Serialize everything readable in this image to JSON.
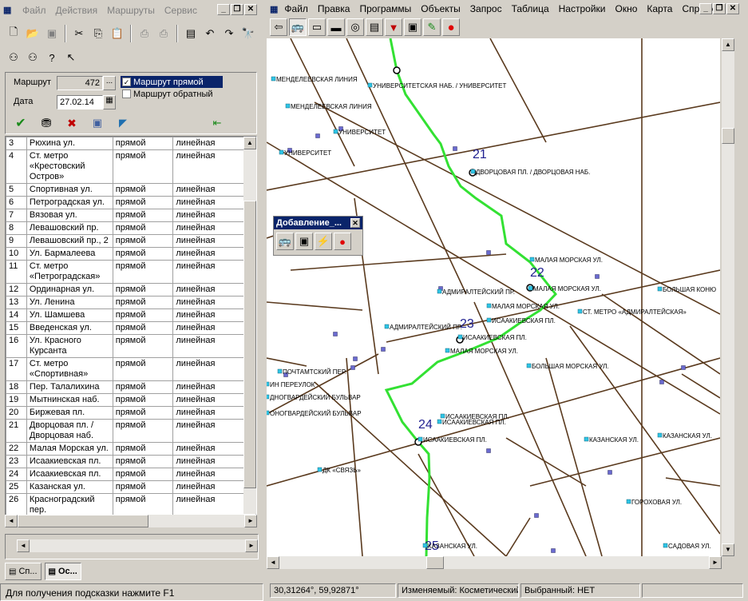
{
  "left_window": {
    "menu": [
      "Файл",
      "Действия",
      "Маршруты",
      "Сервис"
    ],
    "form": {
      "route_label": "Маршрут",
      "route_value": "472",
      "browse_label": "...",
      "date_label": "Дата",
      "date_value": "27.02.14",
      "direct_label": "Маршрут прямой",
      "reverse_label": "Маршрут обратный"
    },
    "rows": [
      [
        "3",
        "Рюхина ул.",
        "прямой",
        "линейная"
      ],
      [
        "4",
        "Ст. метро «Крестовский Остров»",
        "прямой",
        "линейная"
      ],
      [
        "5",
        "Спортивная ул.",
        "прямой",
        "линейная"
      ],
      [
        "6",
        "Петроградская ул.",
        "прямой",
        "линейная"
      ],
      [
        "7",
        "Вязовая ул.",
        "прямой",
        "линейная"
      ],
      [
        "8",
        "Левашовский пр.",
        "прямой",
        "линейная"
      ],
      [
        "9",
        "Левашовский пр., 2",
        "прямой",
        "линейная"
      ],
      [
        "10",
        "Ул. Бармалеева",
        "прямой",
        "линейная"
      ],
      [
        "11",
        "Ст. метро «Петроградская»",
        "прямой",
        "линейная"
      ],
      [
        "12",
        "Ординарная ул.",
        "прямой",
        "линейная"
      ],
      [
        "13",
        "Ул. Ленина",
        "прямой",
        "линейная"
      ],
      [
        "14",
        "Ул. Шамшева",
        "прямой",
        "линейная"
      ],
      [
        "15",
        "Введенская ул.",
        "прямой",
        "линейная"
      ],
      [
        "16",
        "Ул. Красного Курсанта",
        "прямой",
        "линейная"
      ],
      [
        "17",
        "Ст. метро «Спортивная»",
        "прямой",
        "линейная"
      ],
      [
        "18",
        "Пер. Талалихина",
        "прямой",
        "линейная"
      ],
      [
        "19",
        "Мытнинская наб.",
        "прямой",
        "линейная"
      ],
      [
        "20",
        "Биржевая пл.",
        "прямой",
        "линейная"
      ],
      [
        "21",
        "Дворцовая пл. / Дворцовая наб.",
        "прямой",
        "линейная"
      ],
      [
        "22",
        "Малая Морская ул.",
        "прямой",
        "линейная"
      ],
      [
        "23",
        "Исаакиевская пл.",
        "прямой",
        "линейная"
      ],
      [
        "24",
        "Исаакиевская пл.",
        "прямой",
        "линейная"
      ],
      [
        "25",
        "Казанская ул.",
        "прямой",
        "линейная"
      ],
      [
        "26",
        "Красноградский пер.",
        "прямой",
        "линейная"
      ]
    ],
    "taskbar": [
      "Сп...",
      "Ос..."
    ],
    "status": "Для получения подсказки нажмите F1"
  },
  "right_window": {
    "menu": [
      "Файл",
      "Правка",
      "Программы",
      "Объекты",
      "Запрос",
      "Таблица",
      "Настройки",
      "Окно",
      "Карта",
      "Справка"
    ],
    "floating_toolbar_title": "Добавление_...",
    "status": {
      "coords": "30,31264°, 59,92871°",
      "modified": "Изменяемый: Косметический",
      "selected": "Выбранный: НЕТ"
    },
    "map": {
      "stop_numbers": [
        "21",
        "22",
        "23",
        "24",
        "25"
      ],
      "labels": [
        "МЕНДЕЛЕЕВСКАЯ ЛИНИЯ",
        "УНИВЕРСИТЕТСКАЯ НАБ. / УНИВЕРСИТЕТ",
        "МЕНДЕЛЕЕВСКАЯ ЛИНИЯ",
        "УНИВЕРСИТЕТ",
        "УНИВЕРСИТЕТ",
        "ДВОРЦОВАЯ ПЛ. / ДВОРЦОВАЯ НАБ.",
        "МАЛАЯ МОРСКАЯ УЛ.",
        "МАЛАЯ МОРСКАЯ УЛ.",
        "АДМИРАЛТЕЙСКИЙ ПР.",
        "МАЛАЯ МОРСКАЯ УЛ.",
        "ИСААКИЕВСКАЯ ПЛ.",
        "СТ. МЕТРО «АДМИРАЛТЕЙСКАЯ»",
        "БОЛЬШАЯ КОНЮ",
        "АДМИРАЛТЕЙСКИЙ ПР.",
        "ИСААКИЕВСКАЯ ПЛ.",
        "МАЛАЯ МОРСКАЯ УЛ.",
        "БОЛЬШАЯ МОРСКАЯ УЛ.",
        "ПОЧТАМТСКИЙ ПЕР.",
        "ИН ПЕРЕУЛОК",
        "ДНОГВАРДЕЙСКИЙ БУЛЬВАР",
        "ОНОГВАРДЕЙСКИЙ БУЛЬВАР",
        "ИСААКИЕВСКАЯ ПЛ.",
        "ИСААКИЕВСКАЯ ПЛ.",
        "ИСААКИЕВСКАЯ ПЛ.",
        "КАЗАНСКАЯ УЛ.",
        "КАЗАНСКАЯ УЛ.",
        "ДК «СВЯЗЬ»",
        "ГОРОХОВАЯ УЛ.",
        "САДОВАЯ УЛ.",
        "КАЗАНСКАЯ УЛ."
      ]
    }
  },
  "colors": {
    "route": "#33e133",
    "street": "#5a3a1e",
    "stop": "#2ec5e6",
    "node": "#6a6ad0"
  }
}
